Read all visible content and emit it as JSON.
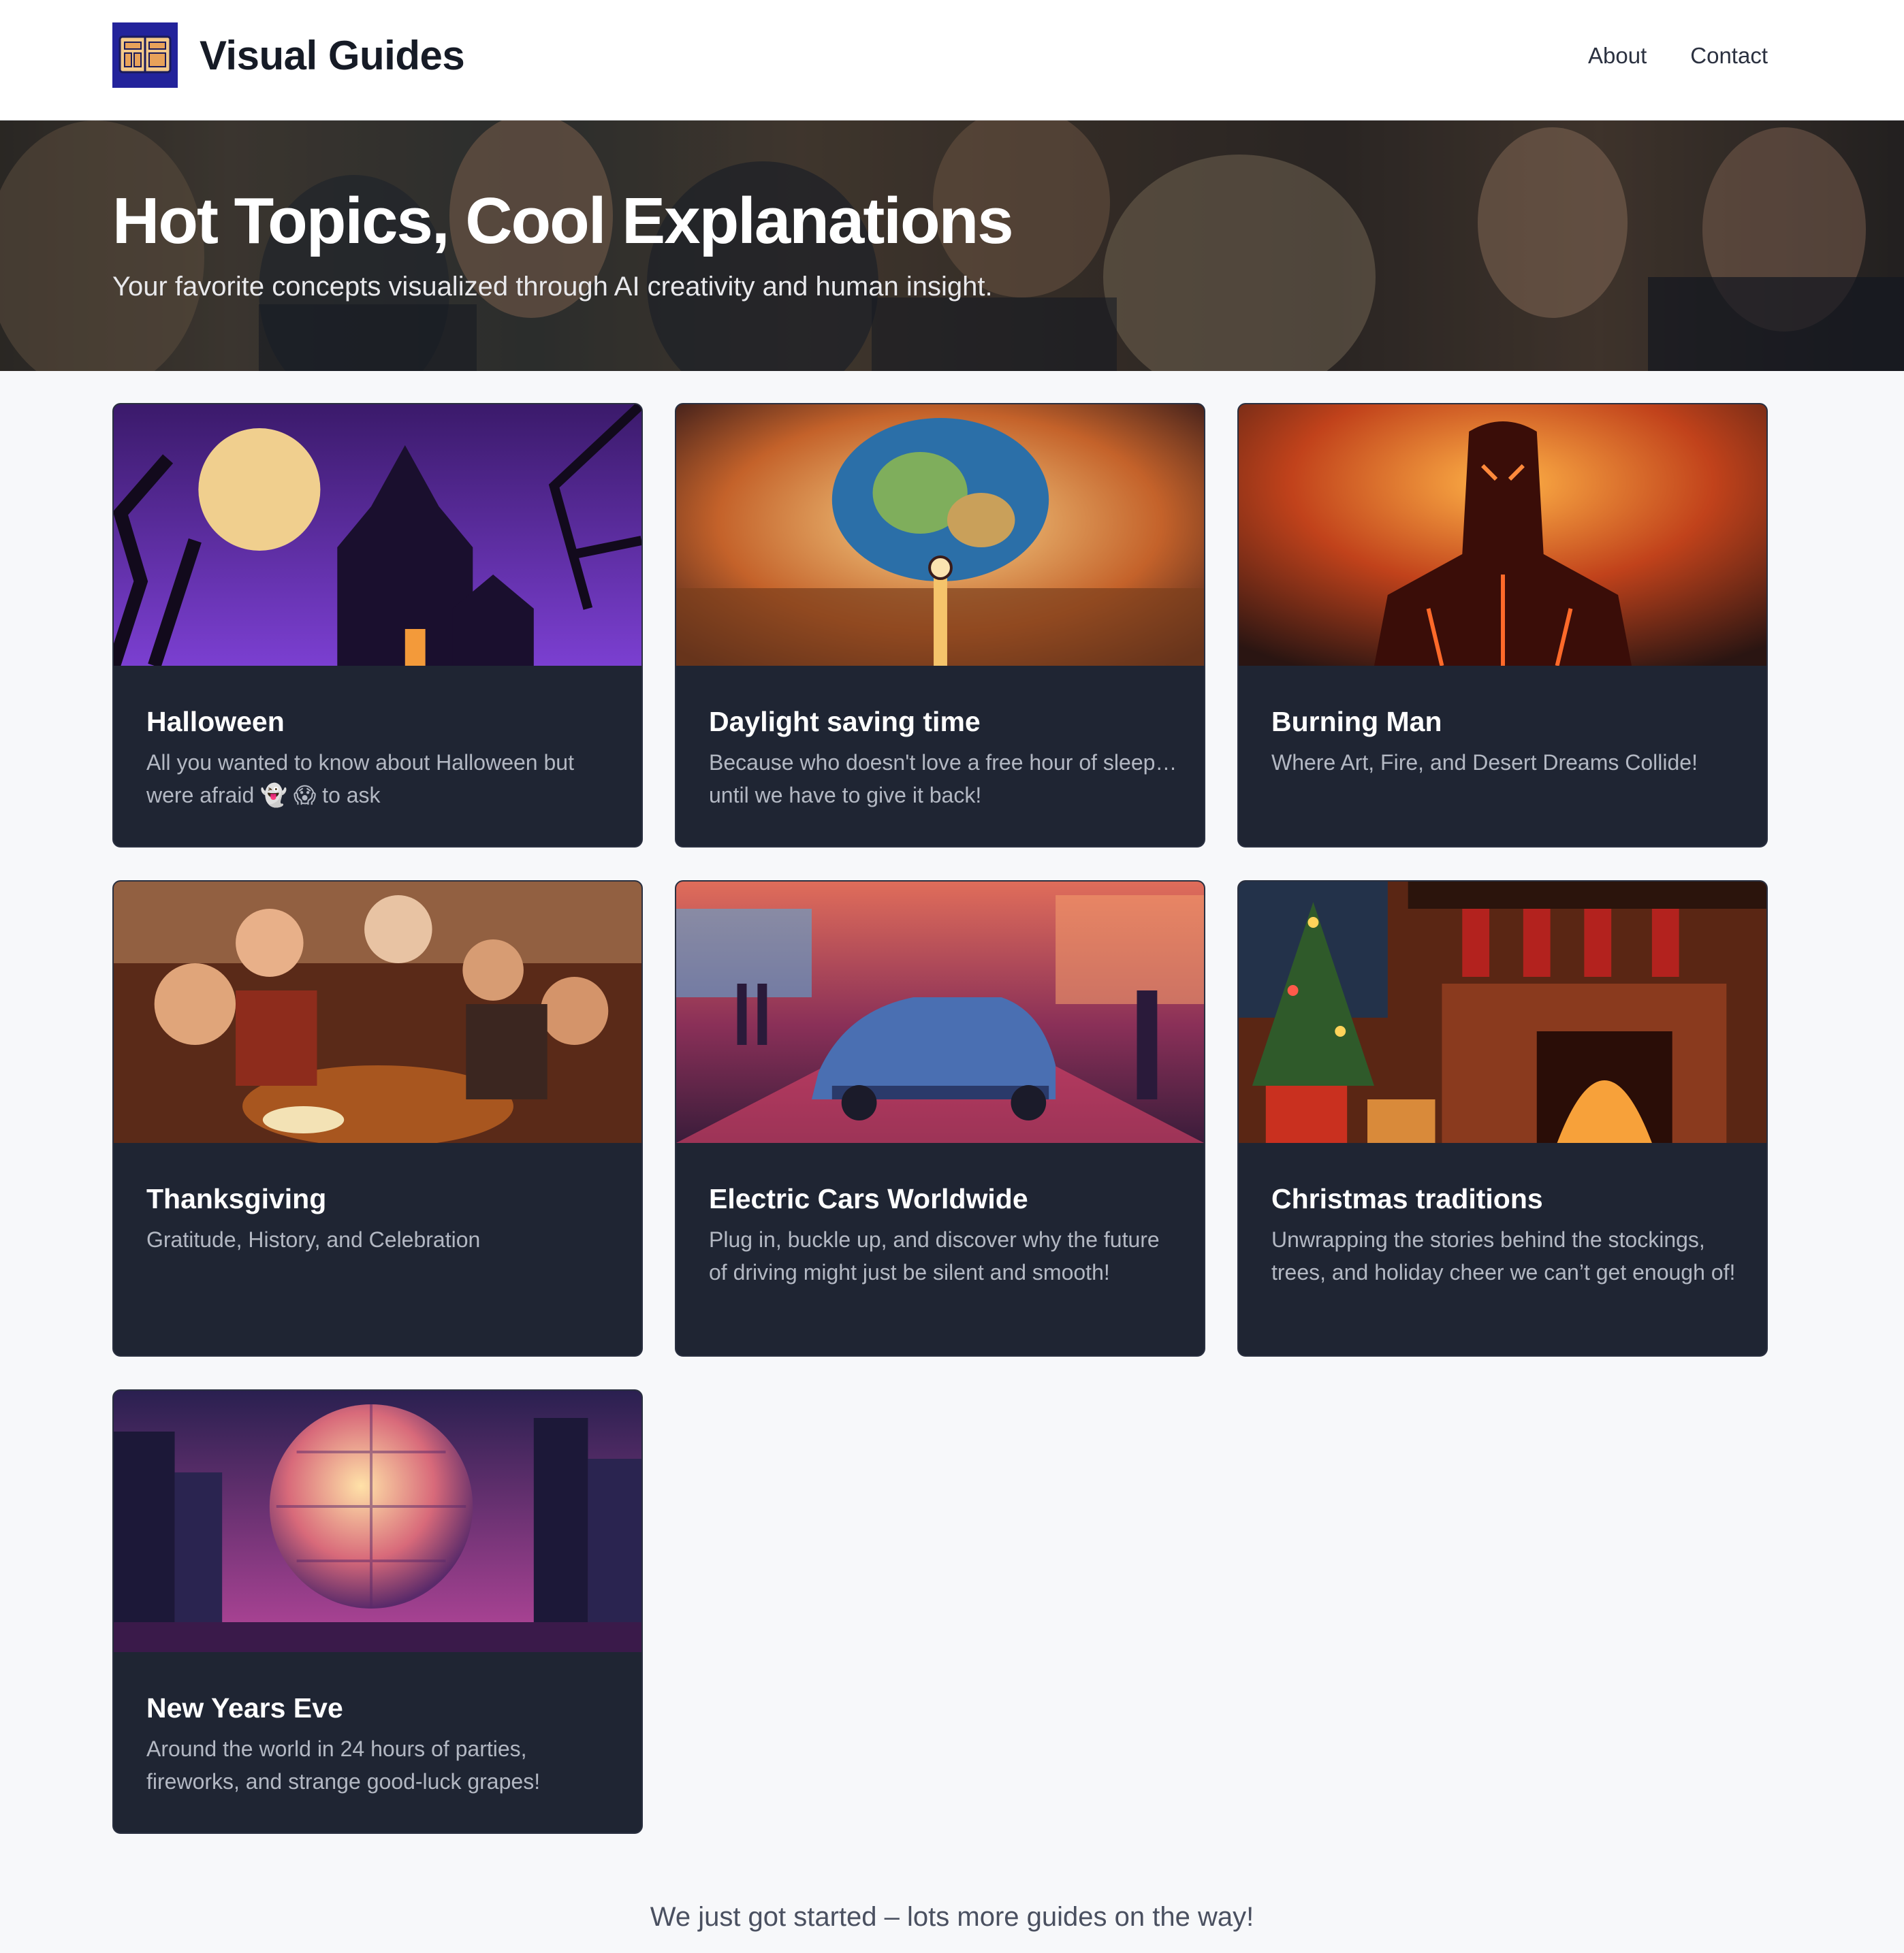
{
  "header": {
    "brand": "Visual Guides",
    "nav": [
      {
        "label": "About"
      },
      {
        "label": "Contact"
      }
    ]
  },
  "hero": {
    "title": "Hot Topics, Cool Explanations",
    "subtitle": "Your favorite concepts visualized through AI creativity and human insight."
  },
  "cards": [
    {
      "title": "Halloween",
      "description": "All you wanted to know about Halloween but were afraid 👻 😱 to ask"
    },
    {
      "title": "Daylight saving time",
      "description": "Because who doesn't love a free hour of sleep… until we have to give it back!"
    },
    {
      "title": "Burning Man",
      "description": "Where Art, Fire, and Desert Dreams Collide!"
    },
    {
      "title": "Thanksgiving",
      "description": "Gratitude, History, and Celebration"
    },
    {
      "title": "Electric Cars Worldwide",
      "description": "Plug in, buckle up, and discover why the future of driving might just be silent and smooth!"
    },
    {
      "title": "Christmas traditions",
      "description": "Unwrapping the stories behind the stockings, trees, and holiday cheer we can’t get enough of!"
    },
    {
      "title": "New Years Eve",
      "description": "Around the world in 24 hours of parties, fireworks, and strange good-luck grapes!"
    }
  ],
  "footer": {
    "note": "We just got started – lots more guides on the way!"
  },
  "colors": {
    "logo_bg": "#23239b",
    "card_bg": "#1f2533",
    "page_bg": "#f7f8fa"
  }
}
